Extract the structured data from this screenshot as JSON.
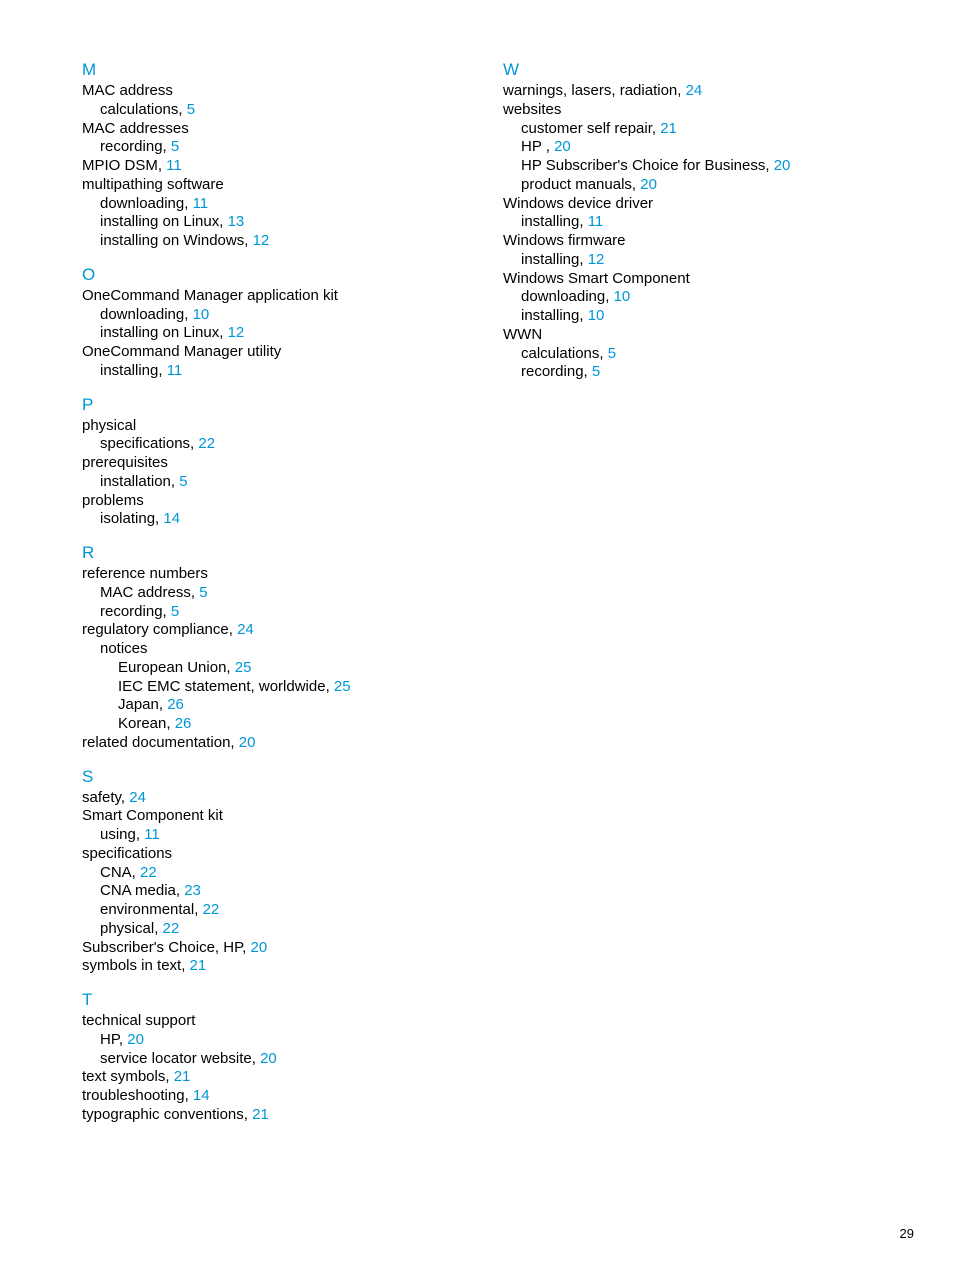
{
  "pageNumber": "29",
  "leftColumn": [
    {
      "type": "letter",
      "text": "M"
    },
    {
      "type": "entry",
      "level": 0,
      "text": "MAC address"
    },
    {
      "type": "entry",
      "level": 1,
      "text": "calculations, ",
      "page": "5"
    },
    {
      "type": "entry",
      "level": 0,
      "text": "MAC addresses"
    },
    {
      "type": "entry",
      "level": 1,
      "text": "recording, ",
      "page": "5"
    },
    {
      "type": "entry",
      "level": 0,
      "text": "MPIO DSM, ",
      "page": "11"
    },
    {
      "type": "entry",
      "level": 0,
      "text": "multipathing software"
    },
    {
      "type": "entry",
      "level": 1,
      "text": "downloading, ",
      "page": "11"
    },
    {
      "type": "entry",
      "level": 1,
      "text": "installing on Linux, ",
      "page": "13"
    },
    {
      "type": "entry",
      "level": 1,
      "text": "installing on Windows, ",
      "page": "12"
    },
    {
      "type": "letter",
      "text": "O"
    },
    {
      "type": "entry",
      "level": 0,
      "text": "OneCommand Manager application kit"
    },
    {
      "type": "entry",
      "level": 1,
      "text": "downloading, ",
      "page": "10"
    },
    {
      "type": "entry",
      "level": 1,
      "text": "installing on Linux, ",
      "page": "12"
    },
    {
      "type": "entry",
      "level": 0,
      "text": "OneCommand Manager utility"
    },
    {
      "type": "entry",
      "level": 1,
      "text": "installing, ",
      "page": "11"
    },
    {
      "type": "letter",
      "text": "P"
    },
    {
      "type": "entry",
      "level": 0,
      "text": "physical"
    },
    {
      "type": "entry",
      "level": 1,
      "text": "specifications, ",
      "page": "22"
    },
    {
      "type": "entry",
      "level": 0,
      "text": "prerequisites"
    },
    {
      "type": "entry",
      "level": 1,
      "text": "installation, ",
      "page": "5"
    },
    {
      "type": "entry",
      "level": 0,
      "text": "problems"
    },
    {
      "type": "entry",
      "level": 1,
      "text": "isolating, ",
      "page": "14"
    },
    {
      "type": "letter",
      "text": "R"
    },
    {
      "type": "entry",
      "level": 0,
      "text": "reference numbers"
    },
    {
      "type": "entry",
      "level": 1,
      "text": "MAC address, ",
      "page": "5"
    },
    {
      "type": "entry",
      "level": 1,
      "text": "recording, ",
      "page": "5"
    },
    {
      "type": "entry",
      "level": 0,
      "text": "regulatory compliance, ",
      "page": "24"
    },
    {
      "type": "entry",
      "level": 1,
      "text": "notices"
    },
    {
      "type": "entry",
      "level": 2,
      "text": "European Union, ",
      "page": "25"
    },
    {
      "type": "entry",
      "level": 2,
      "text": "IEC EMC statement, worldwide, ",
      "page": "25"
    },
    {
      "type": "entry",
      "level": 2,
      "text": "Japan, ",
      "page": "26"
    },
    {
      "type": "entry",
      "level": 2,
      "text": "Korean, ",
      "page": "26"
    },
    {
      "type": "entry",
      "level": 0,
      "text": "related documentation, ",
      "page": "20"
    },
    {
      "type": "letter",
      "text": "S"
    },
    {
      "type": "entry",
      "level": 0,
      "text": "safety, ",
      "page": "24"
    },
    {
      "type": "entry",
      "level": 0,
      "text": "Smart Component kit"
    },
    {
      "type": "entry",
      "level": 1,
      "text": "using, ",
      "page": "11"
    },
    {
      "type": "entry",
      "level": 0,
      "text": "specifications"
    },
    {
      "type": "entry",
      "level": 1,
      "text": "CNA, ",
      "page": "22"
    },
    {
      "type": "entry",
      "level": 1,
      "text": "CNA media, ",
      "page": "23"
    },
    {
      "type": "entry",
      "level": 1,
      "text": "environmental, ",
      "page": "22"
    },
    {
      "type": "entry",
      "level": 1,
      "text": "physical, ",
      "page": "22"
    },
    {
      "type": "entry",
      "level": 0,
      "text": "Subscriber's Choice, HP, ",
      "page": "20"
    },
    {
      "type": "entry",
      "level": 0,
      "text": "symbols in text, ",
      "page": "21"
    },
    {
      "type": "letter",
      "text": "T"
    },
    {
      "type": "entry",
      "level": 0,
      "text": "technical support"
    },
    {
      "type": "entry",
      "level": 1,
      "text": "HP, ",
      "page": "20"
    },
    {
      "type": "entry",
      "level": 1,
      "text": "service locator website, ",
      "page": "20"
    },
    {
      "type": "entry",
      "level": 0,
      "text": "text symbols, ",
      "page": "21"
    },
    {
      "type": "entry",
      "level": 0,
      "text": "troubleshooting, ",
      "page": "14"
    },
    {
      "type": "entry",
      "level": 0,
      "text": "typographic conventions, ",
      "page": "21"
    }
  ],
  "rightColumn": [
    {
      "type": "letter",
      "text": "W"
    },
    {
      "type": "entry",
      "level": 0,
      "text": "warnings, lasers, radiation, ",
      "page": "24"
    },
    {
      "type": "entry",
      "level": 0,
      "text": "websites"
    },
    {
      "type": "entry",
      "level": 1,
      "text": "customer self repair, ",
      "page": "21"
    },
    {
      "type": "entry",
      "level": 1,
      "text": "HP , ",
      "page": "20"
    },
    {
      "type": "entry",
      "level": 1,
      "text": "HP Subscriber's Choice for Business, ",
      "page": "20"
    },
    {
      "type": "entry",
      "level": 1,
      "text": "product manuals, ",
      "page": "20"
    },
    {
      "type": "entry",
      "level": 0,
      "text": "Windows device driver"
    },
    {
      "type": "entry",
      "level": 1,
      "text": "installing, ",
      "page": "11"
    },
    {
      "type": "entry",
      "level": 0,
      "text": "Windows firmware"
    },
    {
      "type": "entry",
      "level": 1,
      "text": "installing, ",
      "page": "12"
    },
    {
      "type": "entry",
      "level": 0,
      "text": "Windows Smart Component"
    },
    {
      "type": "entry",
      "level": 1,
      "text": "downloading, ",
      "page": "10"
    },
    {
      "type": "entry",
      "level": 1,
      "text": "installing, ",
      "page": "10"
    },
    {
      "type": "entry",
      "level": 0,
      "text": "WWN"
    },
    {
      "type": "entry",
      "level": 1,
      "text": "calculations, ",
      "page": "5"
    },
    {
      "type": "entry",
      "level": 1,
      "text": "recording, ",
      "page": "5"
    }
  ]
}
